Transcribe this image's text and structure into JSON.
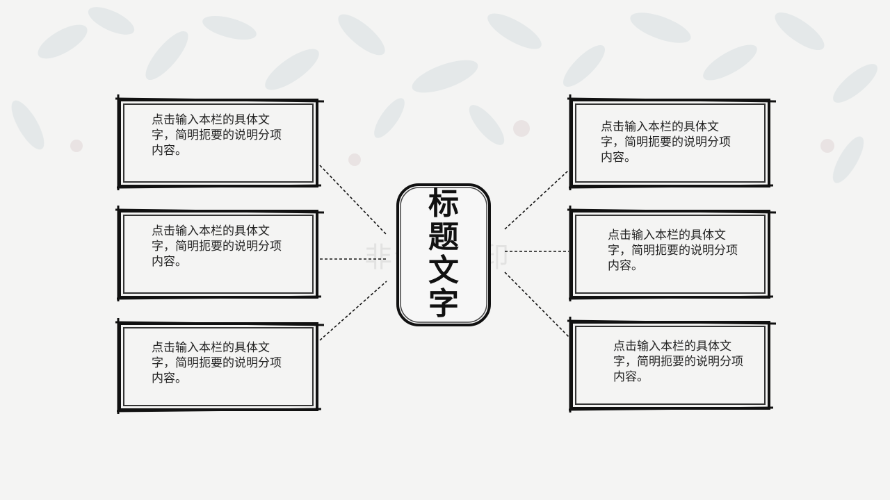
{
  "title": "标题文字",
  "watermark": "非会员水印",
  "items": [
    {
      "text": "点击输入本栏的具体文字，简明扼要的说明分项内容。"
    },
    {
      "text": "点击输入本栏的具体文字，简明扼要的说明分项内容。"
    },
    {
      "text": "点击输入本栏的具体文字，简明扼要的说明分项内容。"
    },
    {
      "text": "点击输入本栏的具体文字，简明扼要的说明分项内容。"
    },
    {
      "text": "点击输入本栏的具体文字，简明扼要的说明分项内容。"
    },
    {
      "text": "点击输入本栏的具体文字，简明扼要的说明分项内容。"
    }
  ],
  "colors": {
    "ink": "#111111",
    "background": "#f4f4f3",
    "leaf": "#dfe5e6"
  }
}
